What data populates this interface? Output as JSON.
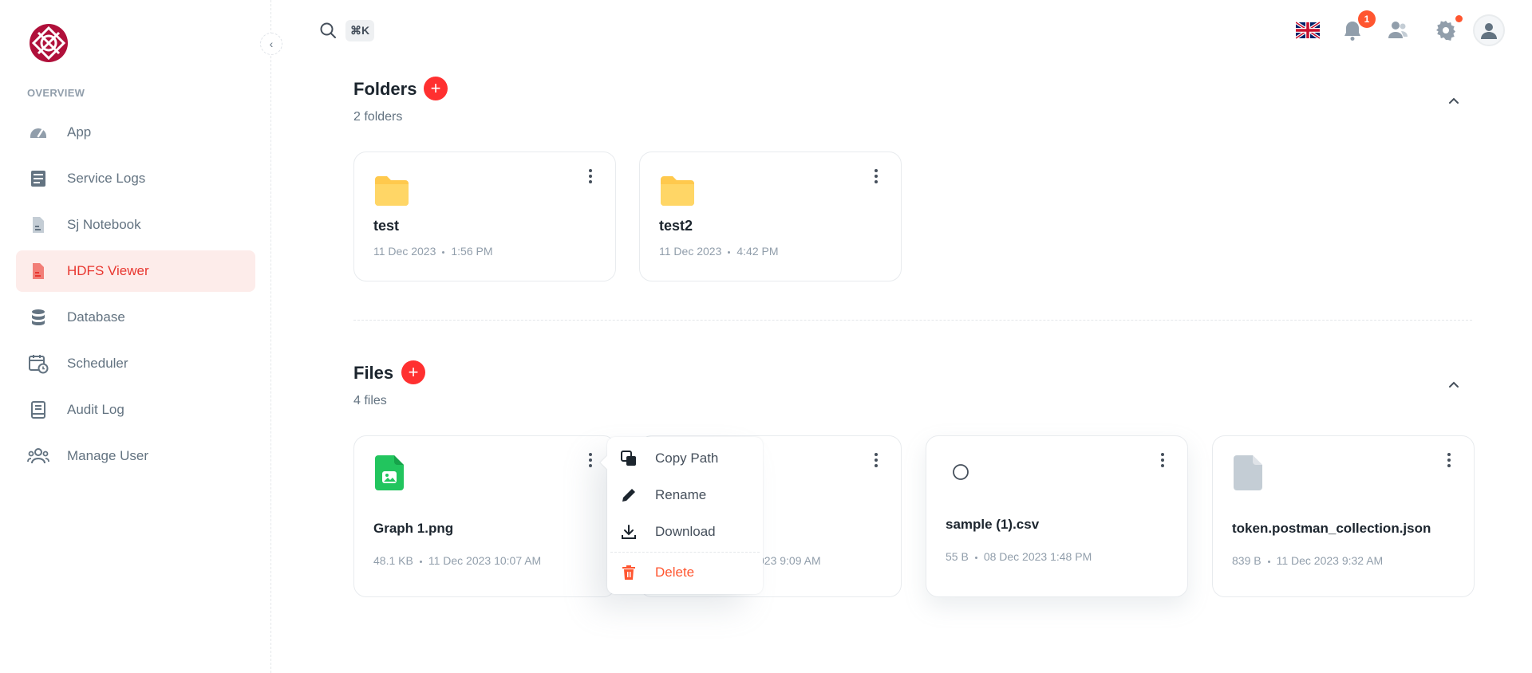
{
  "sidebar": {
    "subheader": "OVERVIEW",
    "items": [
      {
        "label": "App",
        "icon": "gauge-icon"
      },
      {
        "label": "Service Logs",
        "icon": "logs-icon"
      },
      {
        "label": "Sj Notebook",
        "icon": "notebook-icon"
      },
      {
        "label": "HDFS Viewer",
        "icon": "file-viewer-icon",
        "active": true
      },
      {
        "label": "Database",
        "icon": "database-icon"
      },
      {
        "label": "Scheduler",
        "icon": "calendar-clock-icon"
      },
      {
        "label": "Audit Log",
        "icon": "audit-book-icon"
      },
      {
        "label": "Manage User",
        "icon": "users-icon"
      }
    ]
  },
  "topbar": {
    "shortcut": "⌘K",
    "notification_count": "1"
  },
  "folders": {
    "title": "Folders",
    "count_label": "2 folders",
    "items": [
      {
        "name": "test",
        "date": "11 Dec 2023",
        "time": "1:56 PM"
      },
      {
        "name": "test2",
        "date": "11 Dec 2023",
        "time": "4:42 PM"
      }
    ]
  },
  "files": {
    "title": "Files",
    "count_label": "4 files",
    "items": [
      {
        "name": "Graph 1.png",
        "size": "48.1 KB",
        "datetime": "11 Dec 2023 10:07 AM"
      },
      {
        "name": "",
        "size": "",
        "datetime": "023 9:09 AM"
      },
      {
        "name": "sample (1).csv",
        "size": "55 B",
        "datetime": "08 Dec 2023 1:48 PM"
      },
      {
        "name": "token.postman_collection.json",
        "size": "839 B",
        "datetime": "11 Dec 2023 9:32 AM"
      }
    ]
  },
  "context_menu": {
    "copy_path": "Copy Path",
    "rename": "Rename",
    "download": "Download",
    "delete": "Delete"
  },
  "colors": {
    "accent": "#ff3030",
    "active_bg": "#fdecea",
    "folder": "#ffc94d",
    "image_file": "#22c55e"
  }
}
